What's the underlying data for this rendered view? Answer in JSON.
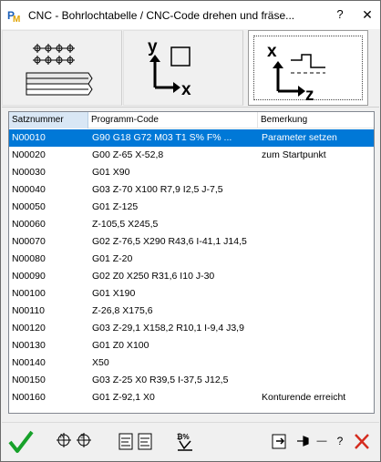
{
  "window": {
    "title": "CNC - Bohrlochtabelle / CNC-Code drehen und fräse...",
    "help_label": "?",
    "close_label": "✕",
    "app_icon": "pm-app-icon"
  },
  "modes": [
    {
      "name": "drill-hole-pattern",
      "icon": "drill-grid-icon",
      "active": false
    },
    {
      "name": "xy-coordinates",
      "icon": "xy-axis-icon",
      "active": false
    },
    {
      "name": "xz-turning",
      "icon": "xz-axis-icon",
      "active": true
    }
  ],
  "table": {
    "columns": [
      "Satznummer",
      "Programm-Code",
      "Bemerkung"
    ],
    "rows": [
      {
        "nr": "N00010",
        "code": "G90 G18 G72 M03 T1 S% F% ...",
        "note": "Parameter setzen",
        "selected": true
      },
      {
        "nr": "N00020",
        "code": "G00  Z-65  X-52,8",
        "note": "zum Startpunkt"
      },
      {
        "nr": "N00030",
        "code": "G01  X90",
        "note": ""
      },
      {
        "nr": "N00040",
        "code": "G03  Z-70  X100 R7,9 I2,5 J-7,5",
        "note": ""
      },
      {
        "nr": "N00050",
        "code": "G01  Z-125",
        "note": ""
      },
      {
        "nr": "N00060",
        "code": "Z-105,5  X245,5",
        "note": ""
      },
      {
        "nr": "N00070",
        "code": "G02  Z-76,5  X290 R43,6 I-41,1 J14,5",
        "note": ""
      },
      {
        "nr": "N00080",
        "code": "G01  Z-20",
        "note": ""
      },
      {
        "nr": "N00090",
        "code": "G02  Z0  X250 R31,6 I10 J-30",
        "note": ""
      },
      {
        "nr": "N00100",
        "code": "G01  X190",
        "note": ""
      },
      {
        "nr": "N00110",
        "code": "Z-26,8  X175,6",
        "note": ""
      },
      {
        "nr": "N00120",
        "code": "G03  Z-29,1  X158,2 R10,1 I-9,4 J3,9",
        "note": ""
      },
      {
        "nr": "N00130",
        "code": "G01  Z0  X100",
        "note": ""
      },
      {
        "nr": "N00140",
        "code": "X50",
        "note": ""
      },
      {
        "nr": "N00150",
        "code": "G03  Z-25  X0 R39,5 I-37,5 J12,5",
        "note": ""
      },
      {
        "nr": "N00160",
        "code": "G01  Z-92,1  X0",
        "note": "Konturende erreicht"
      }
    ]
  },
  "toolbar": {
    "buttons": [
      "ok-check-icon",
      "number-set-icon",
      "list-format-icon",
      "code-tools-icon",
      "export-icon",
      "pin-icon",
      "minimize-icon",
      "help-icon",
      "cancel-icon"
    ],
    "help_label": "?",
    "minimize_label": "—"
  },
  "colors": {
    "selection": "#0078d7",
    "ok_green": "#17a12a",
    "cancel_red": "#d52b1e",
    "header_highlight": "#d9e7f5"
  }
}
